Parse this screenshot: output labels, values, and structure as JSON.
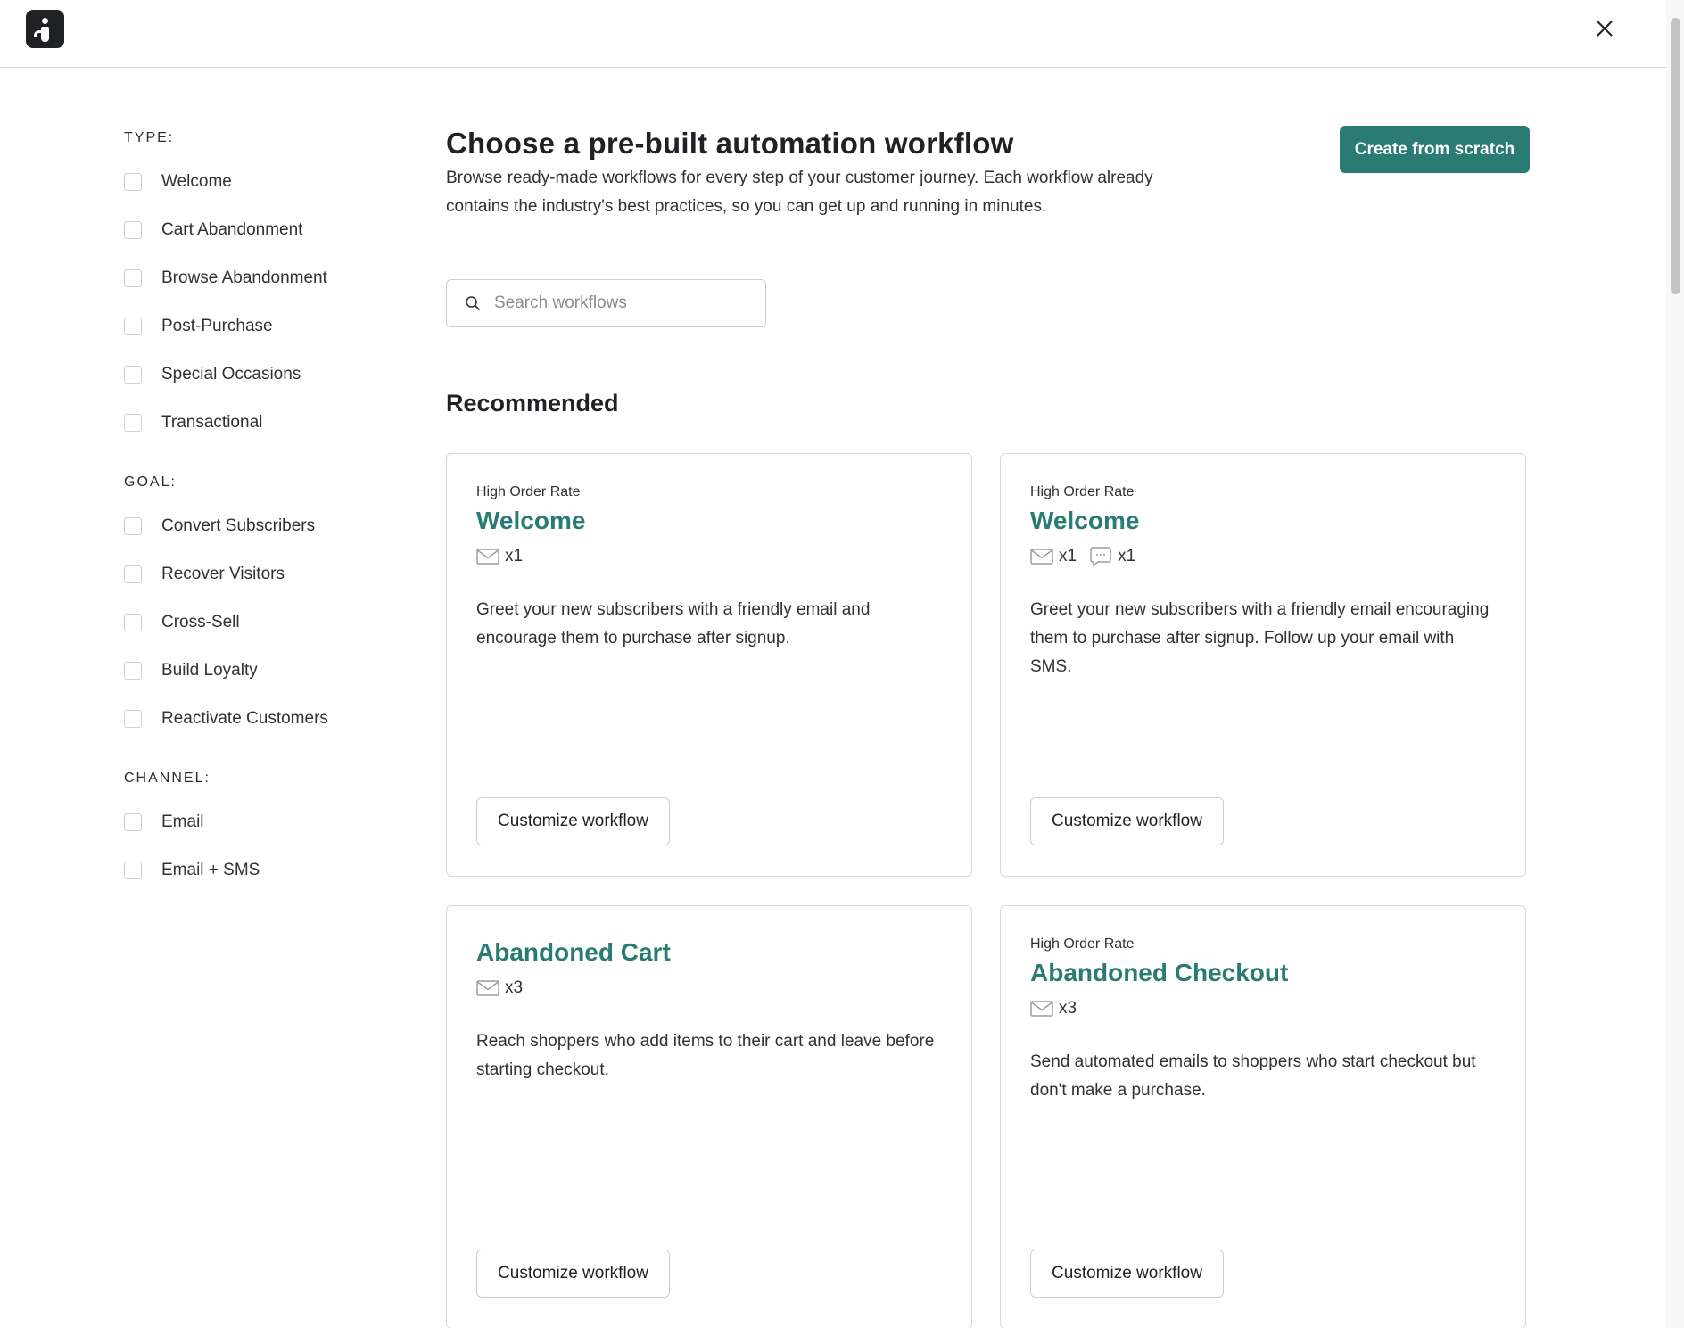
{
  "header": {
    "logo_name": "app-logo",
    "close_icon": "close-icon"
  },
  "filters": {
    "type": {
      "heading": "TYPE:",
      "items": [
        "Welcome",
        "Cart Abandonment",
        "Browse Abandonment",
        "Post-Purchase",
        "Special Occasions",
        "Transactional"
      ]
    },
    "goal": {
      "heading": "GOAL:",
      "items": [
        "Convert Subscribers",
        "Recover Visitors",
        "Cross-Sell",
        "Build Loyalty",
        "Reactivate Customers"
      ]
    },
    "channel": {
      "heading": "CHANNEL:",
      "items": [
        "Email",
        "Email + SMS"
      ]
    }
  },
  "main": {
    "title": "Choose a pre-built automation workflow",
    "description": "Browse ready-made workflows for every step of your customer journey. Each workflow already contains the industry's best practices, so you can get up and running in minutes.",
    "create_button": "Create from scratch",
    "search": {
      "placeholder": "Search workflows",
      "value": ""
    },
    "section_title": "Recommended",
    "cards": [
      {
        "badge": "High Order Rate",
        "title": "Welcome",
        "email_count": "x1",
        "sms_count": "",
        "description": "Greet your new subscribers with a friendly email and encourage them to purchase after signup.",
        "button": "Customize workflow"
      },
      {
        "badge": "High Order Rate",
        "title": "Welcome",
        "email_count": "x1",
        "sms_count": "x1",
        "description": "Greet your new subscribers with a friendly email encouraging them to purchase after signup. Follow up your email with SMS.",
        "button": "Customize workflow"
      },
      {
        "badge": "",
        "title": "Abandoned Cart",
        "email_count": "x3",
        "sms_count": "",
        "description": "Reach shoppers who add items to their cart and leave before starting checkout.",
        "button": "Customize workflow"
      },
      {
        "badge": "High Order Rate",
        "title": "Abandoned Checkout",
        "email_count": "x3",
        "sms_count": "",
        "description": "Send automated emails to shoppers who start checkout but don't make a purchase.",
        "button": "Customize workflow"
      }
    ]
  },
  "colors": {
    "accent": "#2b7b75",
    "text": "#1f2124",
    "border": "#d9d9d9"
  }
}
